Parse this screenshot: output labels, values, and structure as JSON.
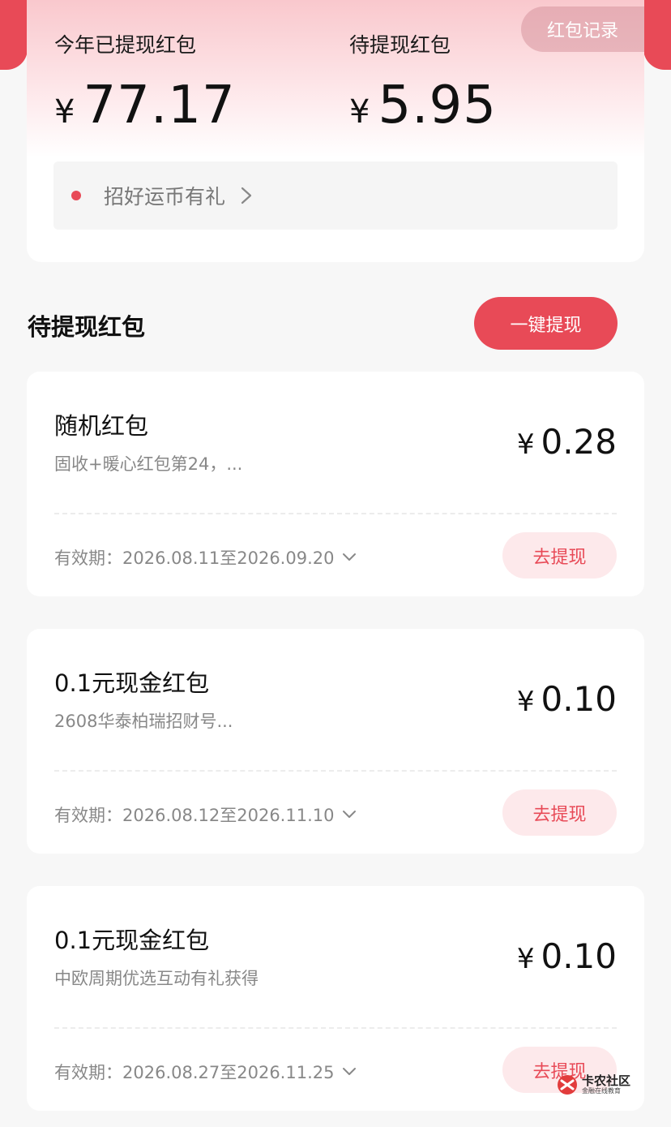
{
  "summary": {
    "record_button": "红包记录",
    "withdrawn_label": "今年已提现红包",
    "withdrawn_currency": "¥",
    "withdrawn_amount": "77.17",
    "pending_label": "待提现红包",
    "pending_currency": "¥",
    "pending_amount": "5.95",
    "promo_text": "招好运币有礼"
  },
  "section": {
    "title": "待提现红包",
    "one_click_button": "一键提现"
  },
  "packets": [
    {
      "name": "随机红包",
      "desc": "固收+暖心红包第24，...",
      "currency": "¥",
      "amount": "0.28",
      "validity": "有效期：2026.08.11至2026.09.20",
      "button": "去提现"
    },
    {
      "name": "0.1元现金红包",
      "desc": "2608华泰柏瑞招财号...",
      "currency": "¥",
      "amount": "0.10",
      "validity": "有效期：2026.08.12至2026.11.10",
      "button": "去提现"
    },
    {
      "name": "0.1元现金红包",
      "desc": "中欧周期优选互动有礼获得",
      "currency": "¥",
      "amount": "0.10",
      "validity": "有效期：2026.08.27至2026.11.25",
      "button": "去提现"
    }
  ],
  "watermark": {
    "title": "卡农社区",
    "subtitle": "金融在线教育"
  },
  "colors": {
    "accent": "#e84a57",
    "button_light": "#fde9eb"
  }
}
